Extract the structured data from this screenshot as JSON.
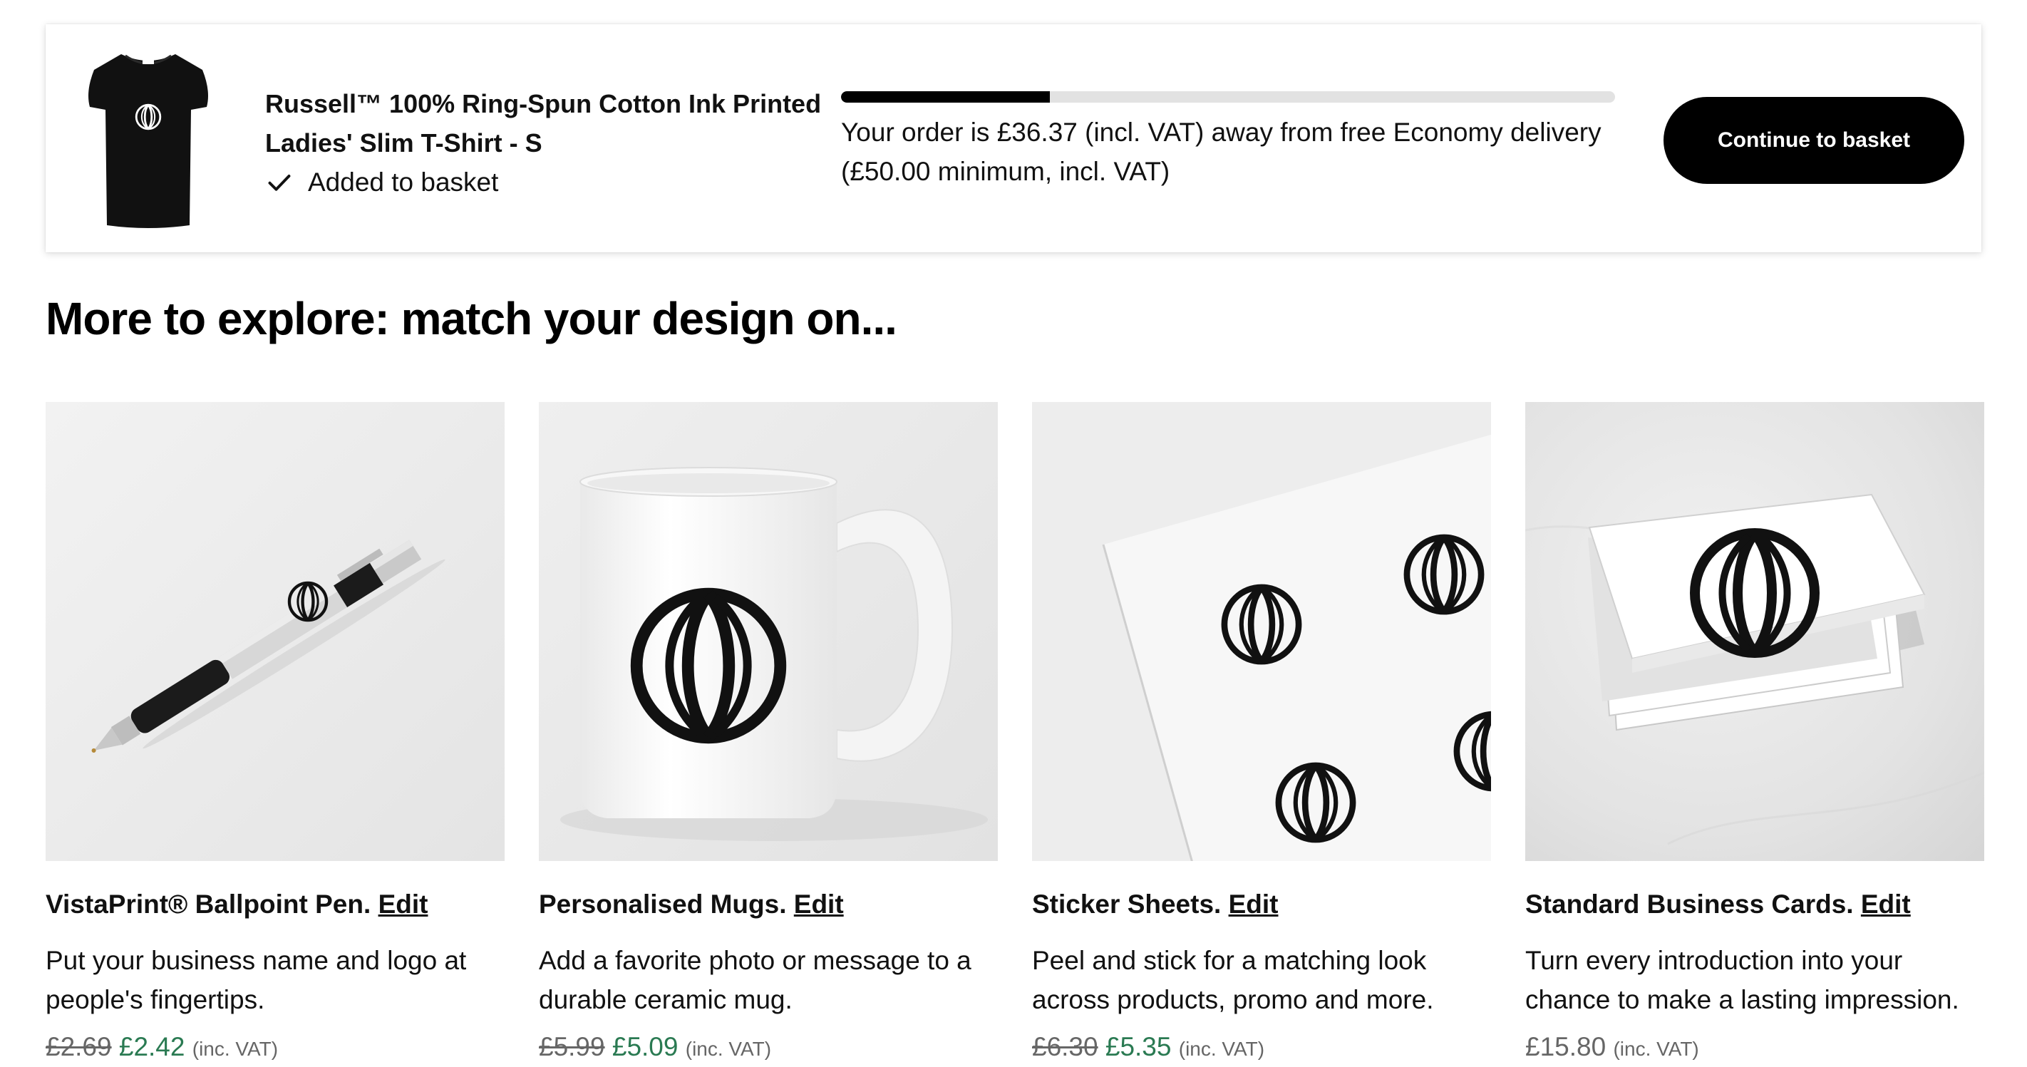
{
  "basket_bar": {
    "product_title": "Russell™ 100% Ring-Spun Cotton Ink Printed Ladies' Slim T-Shirt - S",
    "added_label": "Added to basket",
    "progress_fraction": 0.27,
    "delivery_message": "Your order is £36.37 (incl. VAT) away from free Economy delivery (£50.00 minimum, incl. VAT)",
    "continue_label": "Continue to basket"
  },
  "section": {
    "heading": "More to explore: match your design on..."
  },
  "products": [
    {
      "title": "VistaPrint® Ballpoint Pen.",
      "edit_label": "Edit",
      "description": "Put your business name and logo at people's fingertips.",
      "old_price": "£2.69",
      "price": "£2.42",
      "vat_note": "(inc. VAT)"
    },
    {
      "title": "Personalised Mugs.",
      "edit_label": "Edit",
      "description": "Add a favorite photo or message to a durable ceramic mug.",
      "old_price": "£5.99",
      "price": "£5.09",
      "vat_note": "(inc. VAT)"
    },
    {
      "title": "Sticker Sheets.",
      "edit_label": "Edit",
      "description": "Peel and stick for a matching look across products, promo and more.",
      "old_price": "£6.30",
      "price": "£5.35",
      "vat_note": "(inc. VAT)"
    },
    {
      "title": "Standard Business Cards.",
      "edit_label": "Edit",
      "description": "Turn every introduction into your chance to make a lasting impression.",
      "price": "£15.80",
      "vat_note": "(inc. VAT)"
    }
  ],
  "colors": {
    "sale_price": "#2a7a52",
    "button_bg": "#000000",
    "progress_fill": "#000000",
    "progress_track": "#e2e2e2"
  },
  "icons": {
    "check": "check-icon",
    "logo": "seed-logo-icon"
  }
}
